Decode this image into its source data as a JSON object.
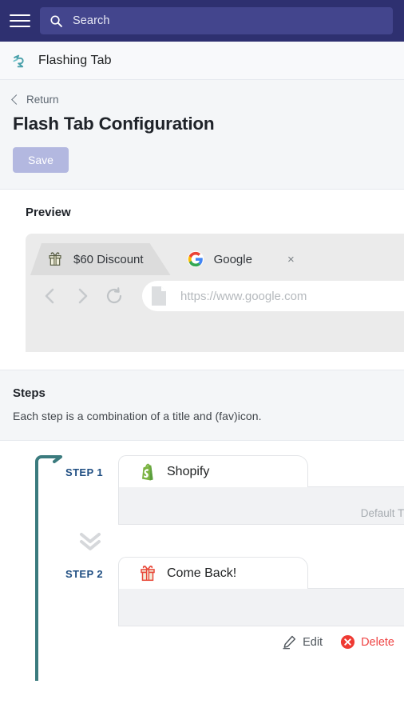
{
  "topbar": {
    "menu_icon": "hamburger-menu-icon",
    "search": {
      "icon": "search-icon",
      "placeholder": "Search",
      "value": ""
    },
    "bg_color": "#2e3070",
    "search_bg_color": "#43458d"
  },
  "brand": {
    "logo_icon": "flashing-tab-logo-icon",
    "name": "Flashing Tab",
    "logo_color": "#4a9ca6"
  },
  "page_header": {
    "return_label": "Return",
    "return_icon": "chevron-left-icon",
    "title": "Flash Tab Configuration",
    "save_label": "Save",
    "save_disabled": true,
    "save_bg_color": "#b3b8e0"
  },
  "preview": {
    "title": "Preview",
    "browser": {
      "tabs": [
        {
          "label": "$60 Discount",
          "favicon": "gift-icon",
          "active": true,
          "closable": false
        },
        {
          "label": "Google",
          "favicon": "google-g-icon",
          "active": false,
          "closable": true,
          "close_label": "×"
        }
      ],
      "nav": {
        "back_icon": "chevron-left-nav-icon",
        "forward_icon": "chevron-right-nav-icon",
        "reload_icon": "reload-icon"
      },
      "url_bar": {
        "page_icon": "page-document-icon",
        "url": "https://www.google.com"
      }
    }
  },
  "steps_header": {
    "title": "Steps",
    "description": "Each step is a combination of a title and (fav)icon."
  },
  "steps": [
    {
      "label": "STEP 1",
      "favicon": "shopify-icon",
      "title": "Shopify",
      "subtitle": "Default Title",
      "has_actions": false
    },
    {
      "label": "STEP 2",
      "favicon": "gift-red-icon",
      "title": "Come Back!",
      "subtitle": "",
      "has_actions": true
    }
  ],
  "step_divider_icon": "chevron-double-down-icon",
  "step_actions": {
    "edit_label": "Edit",
    "edit_icon": "pencil-icon",
    "delete_label": "Delete",
    "delete_icon": "delete-circle-x-icon",
    "delete_color": "#ef4444"
  },
  "colors": {
    "header": "#2e3070",
    "page_bg_gray": "#f4f6f8",
    "timeline": "#3b7b7e",
    "step_label": "#1f4e82",
    "shopify_green": "#5a9e3d",
    "gift_red": "#e8493a"
  }
}
